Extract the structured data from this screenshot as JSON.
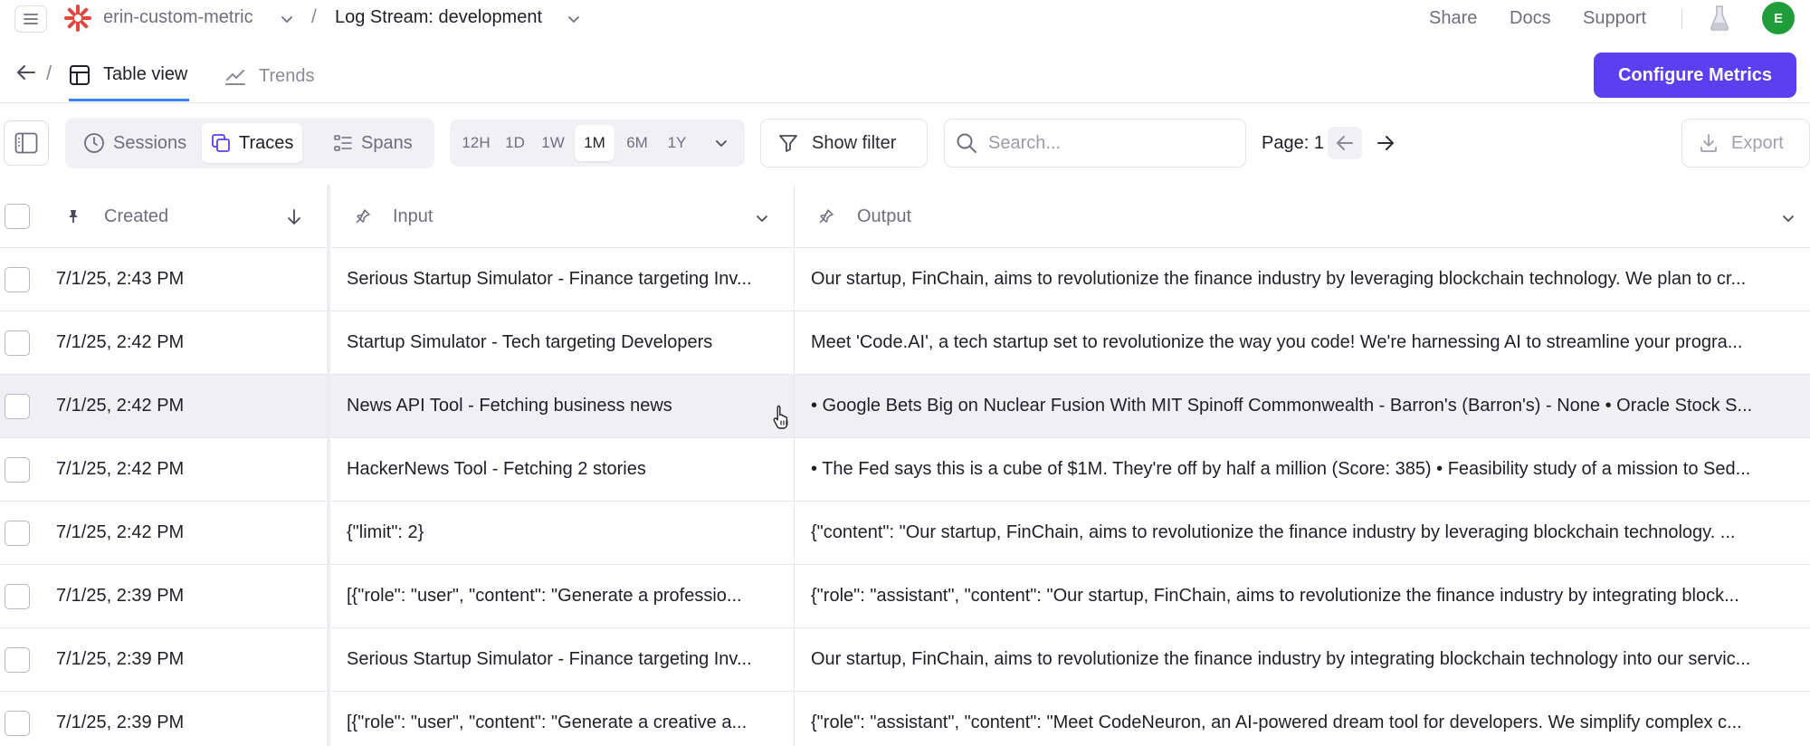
{
  "topbar": {
    "project": "erin-custom-metric",
    "separator": "/",
    "log_stream": "Log Stream: development",
    "links": [
      "Share",
      "Docs",
      "Support"
    ],
    "avatar_initial": "E"
  },
  "viewbar": {
    "separator": "/",
    "tabs": [
      {
        "label": "Table view",
        "active": true
      },
      {
        "label": "Trends",
        "active": false
      }
    ],
    "configure_label": "Configure Metrics"
  },
  "toolbar": {
    "segments": [
      {
        "label": "Sessions",
        "active": false
      },
      {
        "label": "Traces",
        "active": true
      },
      {
        "label": "Spans",
        "active": false
      }
    ],
    "time_ranges": [
      "12H",
      "1D",
      "1W",
      "1M",
      "6M",
      "1Y"
    ],
    "time_active": "1M",
    "filter_label": "Show filter",
    "search_placeholder": "Search...",
    "page_label": "Page: 1",
    "export_label": "Export"
  },
  "table": {
    "columns": [
      "Created",
      "Input",
      "Output"
    ],
    "rows": [
      {
        "created": "7/1/25, 2:43 PM",
        "input": "Serious Startup Simulator - Finance targeting Inv...",
        "output": "Our startup, FinChain, aims to revolutionize the finance industry by leveraging blockchain technology. We plan to cr..."
      },
      {
        "created": "7/1/25, 2:42 PM",
        "input": "Startup Simulator - Tech targeting Developers",
        "output": "Meet 'Code.AI', a tech startup set to revolutionize the way you code! We're harnessing AI to streamline your progra..."
      },
      {
        "created": "7/1/25, 2:42 PM",
        "input": "News API Tool - Fetching business news",
        "output": "• Google Bets Big on Nuclear Fusion With MIT Spinoff Commonwealth - Barron's (Barron's) - None • Oracle Stock S..."
      },
      {
        "created": "7/1/25, 2:42 PM",
        "input": "HackerNews Tool - Fetching 2 stories",
        "output": "• The Fed says this is a cube of $1M. They're off by half a million (Score: 385) • Feasibility study of a mission to Sed..."
      },
      {
        "created": "7/1/25, 2:42 PM",
        "input": "{\"limit\": 2}",
        "output": "{\"content\": \"Our startup, FinChain, aims to revolutionize the finance industry by leveraging blockchain technology. ..."
      },
      {
        "created": "7/1/25, 2:39 PM",
        "input": "[{\"role\": \"user\", \"content\": \"Generate a professio...",
        "output": "{\"role\": \"assistant\", \"content\": \"Our startup, FinChain, aims to revolutionize the finance industry by integrating block..."
      },
      {
        "created": "7/1/25, 2:39 PM",
        "input": "Serious Startup Simulator - Finance targeting Inv...",
        "output": "Our startup, FinChain, aims to revolutionize the finance industry by integrating blockchain technology into our servic..."
      },
      {
        "created": "7/1/25, 2:39 PM",
        "input": "[{\"role\": \"user\", \"content\": \"Generate a creative a...",
        "output": "{\"role\": \"assistant\", \"content\": \"Meet CodeNeuron, an AI-powered dream tool for developers. We simplify complex c..."
      }
    ]
  },
  "colors": {
    "accent": "#5b3ff0",
    "tab_underline": "#3b82f6",
    "avatar": "#1f9d3a",
    "logo": "#e0483c"
  }
}
